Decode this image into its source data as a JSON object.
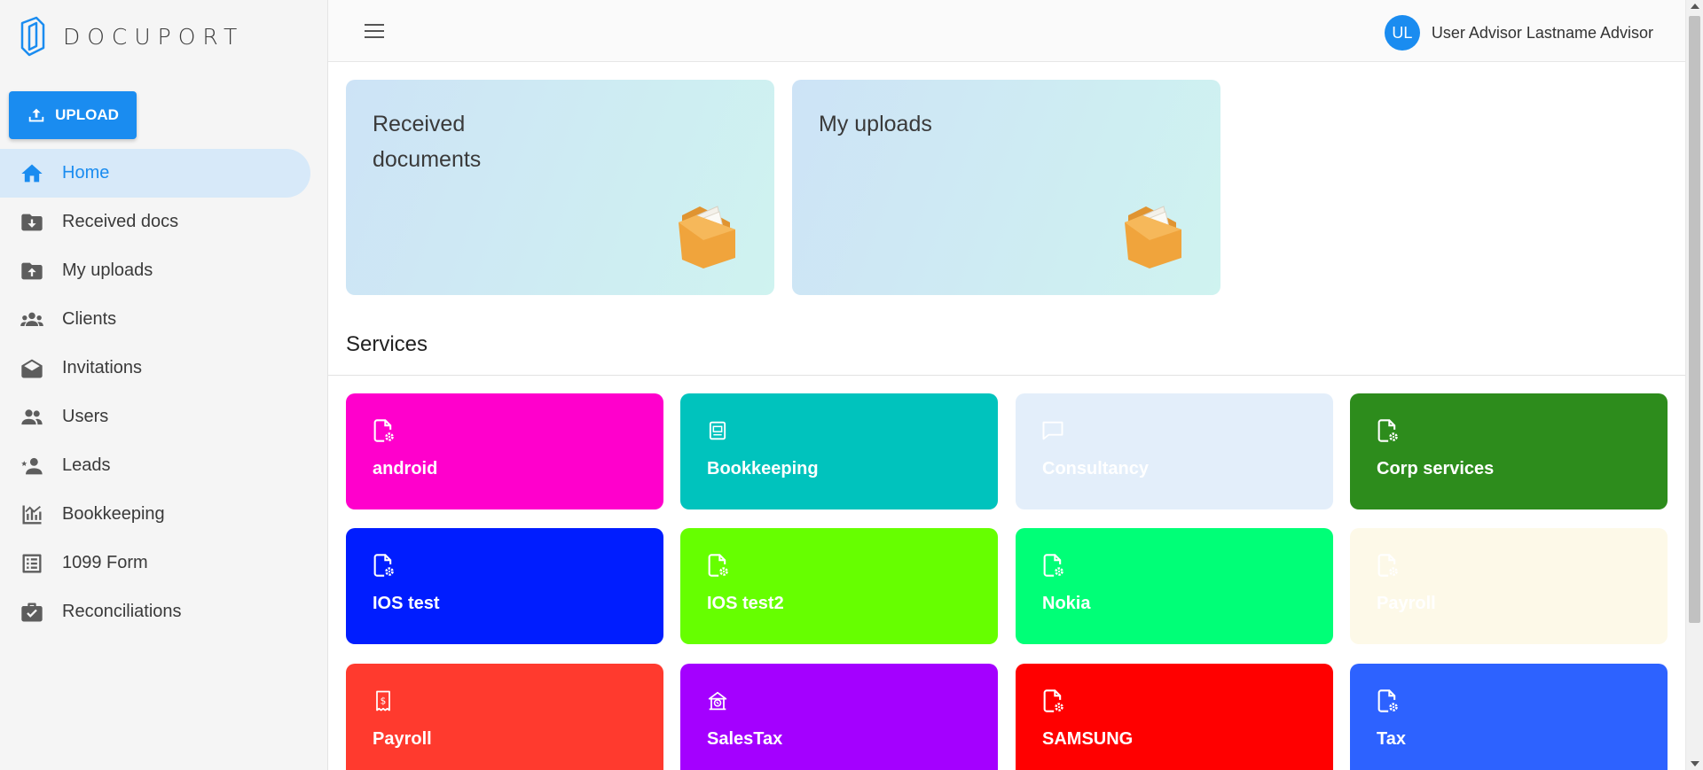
{
  "brand": {
    "name": "DOCUPORT"
  },
  "upload_button": {
    "label": "UPLOAD"
  },
  "sidebar": {
    "items": [
      {
        "label": "Home",
        "icon": "home-icon",
        "active": true
      },
      {
        "label": "Received docs",
        "icon": "folder-download-icon"
      },
      {
        "label": "My uploads",
        "icon": "folder-upload-icon"
      },
      {
        "label": "Clients",
        "icon": "group-icon"
      },
      {
        "label": "Invitations",
        "icon": "envelope-open-icon"
      },
      {
        "label": "Users",
        "icon": "users-icon"
      },
      {
        "label": "Leads",
        "icon": "person-star-icon"
      },
      {
        "label": "Bookkeeping",
        "icon": "chart-icon"
      },
      {
        "label": "1099 Form",
        "icon": "list-form-icon"
      },
      {
        "label": "Reconciliations",
        "icon": "briefcase-check-icon"
      }
    ]
  },
  "header": {
    "avatar_initials": "UL",
    "user_name": "User Advisor Lastname Advisor"
  },
  "cards": [
    {
      "title": "Received documents"
    },
    {
      "title": "My uploads"
    }
  ],
  "services": {
    "title": "Services",
    "items": [
      {
        "label": "android",
        "color": "#ff00cc",
        "icon": "file-gear-icon"
      },
      {
        "label": "Bookkeeping",
        "color": "#00c3bd",
        "icon": "ledger-icon"
      },
      {
        "label": "Consultancy",
        "color": "#e3eefa",
        "icon": "chat-bubble-icon"
      },
      {
        "label": "Corp services",
        "color": "#2d8c1c",
        "icon": "file-gear-icon"
      },
      {
        "label": "IOS test",
        "color": "#001dff",
        "icon": "file-gear-icon"
      },
      {
        "label": "IOS test2",
        "color": "#66ff00",
        "icon": "file-gear-icon"
      },
      {
        "label": "Nokia",
        "color": "#00ff77",
        "icon": "file-gear-icon"
      },
      {
        "label": "Payroll",
        "color": "#fdf9e8",
        "icon": "file-gear-icon"
      },
      {
        "label": "Payroll",
        "color": "#ff3a2e",
        "icon": "receipt-dollar-icon"
      },
      {
        "label": "SalesTax",
        "color": "#a400ff",
        "icon": "tax-building-icon"
      },
      {
        "label": "SAMSUNG",
        "color": "#ff0000",
        "icon": "file-gear-icon"
      },
      {
        "label": "Tax",
        "color": "#2d62ff",
        "icon": "file-gear-icon"
      }
    ]
  }
}
